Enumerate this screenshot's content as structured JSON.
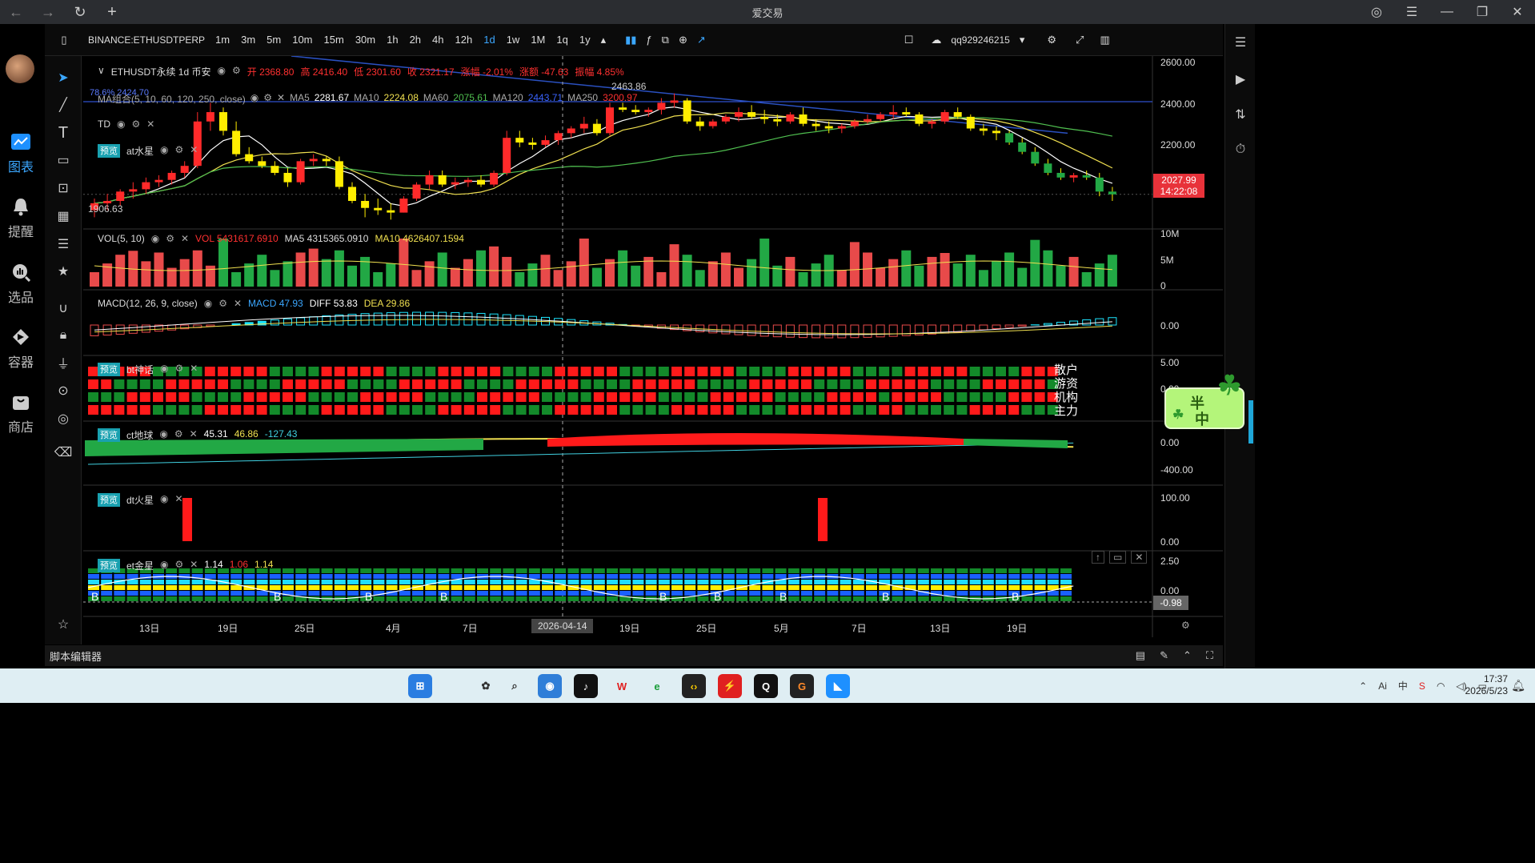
{
  "window": {
    "title": "爱交易",
    "back": "←",
    "forward": "→",
    "reload": "↻",
    "newtab": "+"
  },
  "leftnav": [
    {
      "label": "图表",
      "icon": "chart-icon",
      "active": true
    },
    {
      "label": "提醒",
      "icon": "bell-icon"
    },
    {
      "label": "选品",
      "icon": "screener-icon"
    },
    {
      "label": "容器",
      "icon": "container-icon"
    },
    {
      "label": "商店",
      "icon": "store-icon"
    }
  ],
  "toolbar": {
    "symbol": "BINANCE:ETHUSDTPERP",
    "intervals": [
      "1m",
      "3m",
      "5m",
      "10m",
      "15m",
      "30m",
      "1h",
      "2h",
      "4h",
      "12h",
      "1d",
      "1w",
      "1M",
      "1q",
      "1y"
    ],
    "active_interval": "1d",
    "user": "qq929246215"
  },
  "colors": {
    "up": "#ff2a2a",
    "down": "#ffee00",
    "bull": "#22c55e",
    "accent": "#3ba7ff"
  },
  "main": {
    "title": "ETHUSDT永续 1d 币安",
    "ohlc": {
      "open": "开 2368.80",
      "high": "高 2416.40",
      "low": "低 2301.60",
      "close": "收 2321.17",
      "chg": "涨幅 -2.01%",
      "amt": "涨额 -47.63",
      "amp": "振幅 4.85%"
    },
    "ma_label": "MA组合(5, 10, 60, 120, 250, close)",
    "ma": [
      {
        "k": "MA5",
        "v": "2281.67",
        "c": "#ffffff"
      },
      {
        "k": "MA10",
        "v": "2224.08",
        "c": "#f0e050"
      },
      {
        "k": "MA60",
        "v": "2075.61",
        "c": "#50c050"
      },
      {
        "k": "MA120",
        "v": "2443.71",
        "c": "#3a64ff"
      },
      {
        "k": "MA250",
        "v": "3200.97",
        "c": "#ff3030"
      }
    ],
    "td_label": "TD",
    "at_label": "at水星",
    "low_mark": "1906.63",
    "high_mark": "2463.86",
    "fib_label": "78.6% 2424.70",
    "price_axis": [
      "2600.00",
      "2400.00",
      "2200.00"
    ],
    "price_tag": "2027.99",
    "price_time": "14:22:08"
  },
  "vol": {
    "label": "VOL(5, 10)",
    "vol": "VOL 5431617.6910",
    "ma5": "MA5 4315365.0910",
    "ma10": "MA10 4626407.1594",
    "axis": [
      "10M",
      "5M",
      "0"
    ]
  },
  "macd": {
    "label": "MACD(12, 26, 9, close)",
    "macd": "MACD 47.93",
    "diff": "DIFF 53.83",
    "dea": "DEA 29.86",
    "axis": [
      "0.00"
    ]
  },
  "bt": {
    "badge": "预览",
    "label": "bt神话",
    "rows": [
      "散户",
      "游资",
      "机构",
      "主力"
    ],
    "axis": [
      "5.00",
      "0.00"
    ]
  },
  "ct": {
    "badge": "预览",
    "label": "ct地球",
    "v1": "45.31",
    "v2": "46.86",
    "v3": "-127.43",
    "axis": [
      "0.00",
      "-400.00"
    ]
  },
  "dt": {
    "badge": "预览",
    "label": "dt火星",
    "axis": [
      "100.00",
      "0.00"
    ]
  },
  "et": {
    "badge": "预览",
    "label": "et金星",
    "v1": "1.14",
    "v2": "1.06",
    "v3": "1.14",
    "axis": [
      "2.50",
      "0.00"
    ],
    "tag": "-0.98"
  },
  "time_axis": [
    "13日",
    "19日",
    "25日",
    "4月",
    "7日",
    "2026-04-14",
    "19日",
    "25日",
    "5月",
    "7日",
    "13日",
    "19日"
  ],
  "crosshair_date": "2026-04-14",
  "script_editor": "脚本编辑器",
  "sticker": {
    "line1": "半",
    "line2": "中"
  },
  "taskbar": {
    "time": "17:37",
    "date": "2026/5/23"
  },
  "chart_data": {
    "type": "candlestick",
    "series": [
      {
        "name": "ETHUSDT",
        "ohlc": [
          [
            1960,
            2010,
            1930,
            1990
          ],
          [
            1990,
            2030,
            1960,
            2000
          ],
          [
            2000,
            2050,
            1980,
            2040
          ],
          [
            2040,
            2080,
            2010,
            2050
          ],
          [
            2050,
            2100,
            2030,
            2080
          ],
          [
            2080,
            2110,
            2060,
            2090
          ],
          [
            2090,
            2130,
            2070,
            2120
          ],
          [
            2120,
            2170,
            2100,
            2150
          ],
          [
            2150,
            2380,
            2140,
            2340
          ],
          [
            2340,
            2420,
            2300,
            2380
          ],
          [
            2380,
            2400,
            2280,
            2300
          ],
          [
            2300,
            2340,
            2190,
            2200
          ],
          [
            2200,
            2230,
            2160,
            2170
          ],
          [
            2170,
            2190,
            2140,
            2150
          ],
          [
            2150,
            2170,
            2110,
            2120
          ],
          [
            2120,
            2140,
            2060,
            2080
          ],
          [
            2080,
            2180,
            2070,
            2170
          ],
          [
            2170,
            2200,
            2150,
            2180
          ],
          [
            2180,
            2190,
            2150,
            2170
          ],
          [
            2170,
            2190,
            2050,
            2060
          ],
          [
            2060,
            2080,
            1990,
            2000
          ],
          [
            2000,
            2030,
            1930,
            1970
          ],
          [
            1970,
            2010,
            1940,
            1960
          ],
          [
            1960,
            1990,
            1920,
            1950
          ],
          [
            1950,
            2020,
            1950,
            2010
          ],
          [
            2010,
            2080,
            2000,
            2070
          ],
          [
            2070,
            2130,
            2050,
            2110
          ],
          [
            2110,
            2130,
            2060,
            2070
          ],
          [
            2070,
            2100,
            2050,
            2080
          ],
          [
            2080,
            2100,
            2060,
            2090
          ],
          [
            2090,
            2110,
            2060,
            2070
          ],
          [
            2070,
            2130,
            2060,
            2120
          ],
          [
            2120,
            2300,
            2110,
            2270
          ],
          [
            2270,
            2300,
            2230,
            2250
          ],
          [
            2250,
            2270,
            2220,
            2240
          ],
          [
            2240,
            2280,
            2230,
            2260
          ],
          [
            2260,
            2300,
            2240,
            2290
          ],
          [
            2290,
            2320,
            2270,
            2310
          ],
          [
            2310,
            2360,
            2290,
            2330
          ],
          [
            2330,
            2350,
            2280,
            2290
          ],
          [
            2290,
            2420,
            2280,
            2400
          ],
          [
            2400,
            2420,
            2380,
            2390
          ],
          [
            2390,
            2410,
            2370,
            2380
          ],
          [
            2380,
            2400,
            2360,
            2390
          ],
          [
            2390,
            2440,
            2370,
            2420
          ],
          [
            2420,
            2460,
            2400,
            2430
          ],
          [
            2430,
            2440,
            2330,
            2340
          ],
          [
            2340,
            2360,
            2300,
            2320
          ],
          [
            2320,
            2350,
            2310,
            2340
          ],
          [
            2340,
            2370,
            2330,
            2360
          ],
          [
            2360,
            2400,
            2340,
            2380
          ],
          [
            2380,
            2410,
            2350,
            2360
          ],
          [
            2360,
            2390,
            2330,
            2350
          ],
          [
            2350,
            2370,
            2320,
            2340
          ],
          [
            2340,
            2380,
            2330,
            2370
          ],
          [
            2370,
            2400,
            2320,
            2330
          ],
          [
            2330,
            2350,
            2300,
            2320
          ],
          [
            2320,
            2340,
            2290,
            2310
          ],
          [
            2310,
            2330,
            2290,
            2320
          ],
          [
            2320,
            2350,
            2310,
            2340
          ],
          [
            2340,
            2370,
            2330,
            2350
          ],
          [
            2350,
            2380,
            2340,
            2370
          ],
          [
            2370,
            2410,
            2350,
            2380
          ],
          [
            2380,
            2400,
            2360,
            2370
          ],
          [
            2370,
            2380,
            2320,
            2330
          ],
          [
            2330,
            2350,
            2310,
            2340
          ],
          [
            2340,
            2390,
            2330,
            2380
          ],
          [
            2380,
            2400,
            2350,
            2360
          ],
          [
            2360,
            2370,
            2300,
            2310
          ],
          [
            2310,
            2330,
            2280,
            2300
          ],
          [
            2300,
            2320,
            2260,
            2290
          ],
          [
            2290,
            2300,
            2240,
            2250
          ],
          [
            2250,
            2270,
            2200,
            2210
          ],
          [
            2210,
            2230,
            2150,
            2160
          ],
          [
            2160,
            2180,
            2110,
            2120
          ],
          [
            2120,
            2140,
            2090,
            2100
          ],
          [
            2100,
            2120,
            2080,
            2110
          ],
          [
            2110,
            2130,
            2090,
            2100
          ],
          [
            2100,
            2120,
            2020,
            2040
          ],
          [
            2040,
            2060,
            2000,
            2028
          ]
        ]
      }
    ]
  }
}
